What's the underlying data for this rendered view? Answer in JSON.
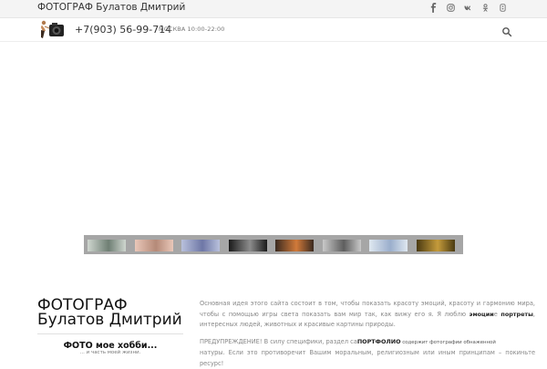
{
  "topbar": {
    "site_title": "ФОТОГРАФ Булатов Дмитрий",
    "socials": [
      "facebook-icon",
      "instagram-icon",
      "vk-icon",
      "odnoklassniki-icon",
      "tripadvisor-icon"
    ]
  },
  "header": {
    "phone": "+7(903) 56-99-714",
    "hours": "МОСКВА 10:00-22:00"
  },
  "gallery": {
    "thumbs": [
      {
        "name": "thumb-1",
        "color1": "#cfd6cf",
        "color2": "#6f7f74"
      },
      {
        "name": "thumb-2",
        "color1": "#e9c7b9",
        "color2": "#b58a78"
      },
      {
        "name": "thumb-3",
        "color1": "#b9c1dc",
        "color2": "#6e77a6"
      },
      {
        "name": "thumb-4",
        "color1": "#1a1a1a",
        "color2": "#8c8c8c"
      },
      {
        "name": "thumb-5",
        "color1": "#3a2a20",
        "color2": "#d17a3a"
      },
      {
        "name": "thumb-6",
        "color1": "#c9c9c9",
        "color2": "#5e5e5e"
      },
      {
        "name": "thumb-7",
        "color1": "#dfe8f0",
        "color2": "#9aaecc"
      },
      {
        "name": "thumb-8",
        "color1": "#4a3a12",
        "color2": "#c59b3b"
      }
    ]
  },
  "intro": {
    "title_line1": "ФОТОГРАФ",
    "title_line2": "Булатов Дмитрий",
    "hobby": "ФОТО мое хобби...",
    "hobby_sub": "... и часть моей жизни.",
    "p1_part1": "Основная идея этого сайта состоит в том, чтобы показать красоту эмоций, красоту и гармонию мира, чтобы с помощью игры света показать вам мир так, как вижу его я. Я люблю ",
    "p1_bold1": "эмоции",
    "p1_part2": "е ",
    "p1_bold2": "портреты",
    "p1_part3": ", интересных людей, животных и красивые картины природы.",
    "p2_part1": "ПРЕДУПРЕЖДЕНИЕ! В силу специфики, раздел са",
    "p2_bold": "ПОРТФОЛИО",
    "p2_small": " содержит фотографии обнаженной",
    "p2_part2": "натуры. Если это противоречит Вашим моральным, религиозным или иным принципам – покиньте ресурс!"
  }
}
